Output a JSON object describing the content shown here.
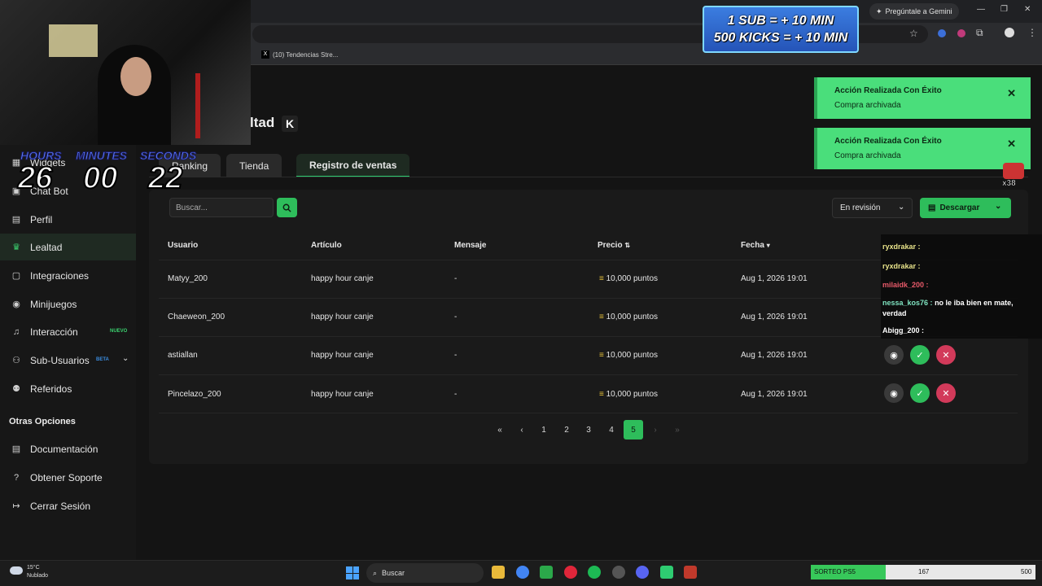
{
  "browser": {
    "tab_title": "(10) Tendencias Stre...",
    "gemini_label": "Pregúntale a Gemini"
  },
  "stream_overlay": {
    "banner_line1": "1 SUB = + 10 MIN",
    "banner_line2": "500 KICKS = + 10 MIN",
    "timer": {
      "hours_label": "HOURS",
      "minutes_label": "MINUTES",
      "seconds_label": "SECONDS",
      "hours": "26",
      "minutes": "00",
      "seconds": "22"
    },
    "chat": [
      {
        "user": "ryxdrakar :",
        "text": ""
      },
      {
        "user": "ryxdrakar :",
        "text": ""
      },
      {
        "user": "milaidk_200 :",
        "text": ""
      },
      {
        "user": "nessa_kos76 :",
        "text": "no le iba bien en mate, verdad"
      },
      {
        "user": "Abigg_200 :",
        "text": ""
      }
    ],
    "counter_badge": "x38"
  },
  "sidebar": {
    "items": [
      {
        "label": "Widgets",
        "icon": "widgets-icon"
      },
      {
        "label": "Chat Bot",
        "icon": "chatbot-icon"
      },
      {
        "label": "Perfil",
        "icon": "profile-icon"
      },
      {
        "label": "Lealtad",
        "icon": "trophy-icon"
      },
      {
        "label": "Integraciones",
        "icon": "integrations-icon"
      },
      {
        "label": "Minijuegos",
        "icon": "gamepad-icon"
      },
      {
        "label": "Interacción",
        "icon": "music-icon",
        "badge": "NUEVO"
      },
      {
        "label": "Sub-Usuarios",
        "icon": "users-icon",
        "badge": "BETA"
      },
      {
        "label": "Referidos",
        "icon": "referrals-icon"
      }
    ],
    "section_title": "Otras Opciones",
    "other": [
      {
        "label": "Documentación",
        "icon": "docs-icon"
      },
      {
        "label": "Obtener Soporte",
        "icon": "help-icon"
      },
      {
        "label": "Cerrar Sesión",
        "icon": "logout-icon"
      }
    ]
  },
  "page": {
    "title": "ltad",
    "tabs": [
      "Ranking",
      "Tienda",
      "Registro de ventas"
    ],
    "active_tab": "Registro de ventas"
  },
  "toolbar": {
    "search_placeholder": "Buscar...",
    "filter_value": "En revisión",
    "download_label": "Descargar"
  },
  "table": {
    "headers": [
      "Usuario",
      "Artículo",
      "Mensaje",
      "Precio",
      "Fecha"
    ],
    "rows": [
      {
        "usuario": "Matyy_200",
        "articulo": "happy hour canje",
        "mensaje": "-",
        "precio": "10,000 puntos",
        "fecha": "Aug 1, 2026 19:01"
      },
      {
        "usuario": "Chaeweon_200",
        "articulo": "happy hour canje",
        "mensaje": "-",
        "precio": "10,000 puntos",
        "fecha": "Aug 1, 2026 19:01"
      },
      {
        "usuario": "astiallan",
        "articulo": "happy hour canje",
        "mensaje": "-",
        "precio": "10,000 puntos",
        "fecha": "Aug 1, 2026 19:01"
      },
      {
        "usuario": "Pincelazo_200",
        "articulo": "happy hour canje",
        "mensaje": "-",
        "precio": "10,000 puntos",
        "fecha": "Aug 1, 2026 19:01"
      }
    ]
  },
  "pagination": {
    "pages": [
      "1",
      "2",
      "3",
      "4",
      "5"
    ],
    "current": "5"
  },
  "toasts": [
    {
      "title": "Acción Realizada Con Éxito",
      "message": "Compra archivada"
    },
    {
      "title": "Acción Realizada Con Éxito",
      "message": "Compra archivada"
    }
  ],
  "taskbar": {
    "weather_temp": "15°C",
    "weather_desc": "Nublado",
    "search_label": "Buscar",
    "sorteo_label": "SORTEO PS5",
    "sorteo_value": "167",
    "sorteo_goal": "500",
    "sorteo_progress": 0.334
  },
  "colors": {
    "accent": "#2ebd5b",
    "danger": "#d23a5a",
    "toast": "#4ade7b"
  }
}
